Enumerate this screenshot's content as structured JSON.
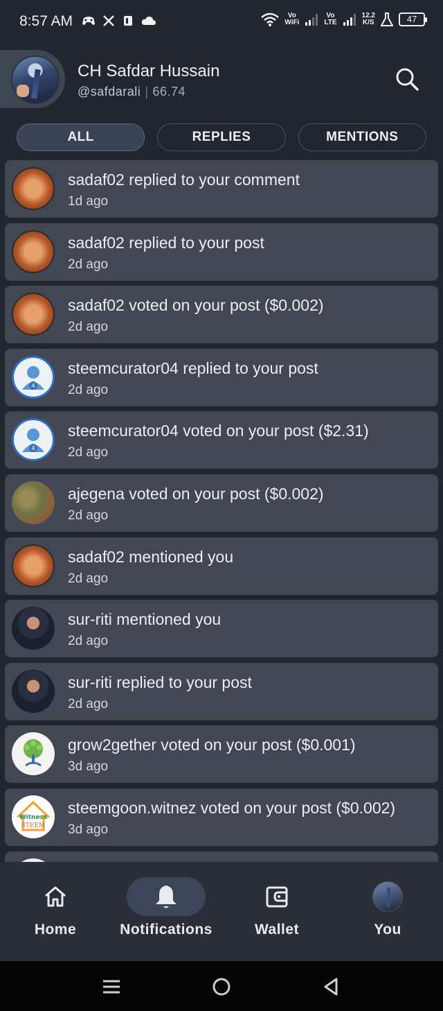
{
  "status_bar": {
    "time": "8:57 AM",
    "left_icons": [
      "gamepad-icon",
      "x-icon",
      "app-icon",
      "cloud-icon"
    ],
    "wifi_label": "Vo\nWiFi",
    "lte_label": "Vo\nLTE",
    "speed": "12.2\nK/S",
    "battery": "47"
  },
  "header": {
    "name": "CH Safdar Hussain",
    "handle": "@safdarali",
    "reputation": "66.74"
  },
  "tabs": [
    {
      "label": "ALL",
      "active": true
    },
    {
      "label": "REPLIES",
      "active": false
    },
    {
      "label": "MENTIONS",
      "active": false
    }
  ],
  "notifications": [
    {
      "text": "sadaf02 replied to your comment",
      "time": "1d ago",
      "avatar": "sadaf"
    },
    {
      "text": "sadaf02 replied to your post",
      "time": "2d ago",
      "avatar": "sadaf"
    },
    {
      "text": "sadaf02 voted on your post ($0.002)",
      "time": "2d ago",
      "avatar": "sadaf"
    },
    {
      "text": "steemcurator04 replied to your post",
      "time": "2d ago",
      "avatar": "steem"
    },
    {
      "text": "steemcurator04 voted on your post ($2.31)",
      "time": "2d ago",
      "avatar": "steem"
    },
    {
      "text": "ajegena voted on your post ($0.002)",
      "time": "2d ago",
      "avatar": "ajegena"
    },
    {
      "text": "sadaf02 mentioned you",
      "time": "2d ago",
      "avatar": "sadaf"
    },
    {
      "text": "sur-riti mentioned you",
      "time": "2d ago",
      "avatar": "sur"
    },
    {
      "text": "sur-riti replied to your post",
      "time": "2d ago",
      "avatar": "sur"
    },
    {
      "text": "grow2gether voted on your post ($0.001)",
      "time": "3d ago",
      "avatar": "grow"
    },
    {
      "text": "steemgoon.witnez voted on your post ($0.002)",
      "time": "3d ago",
      "avatar": "witnez"
    }
  ],
  "bottom_nav": [
    {
      "label": "Home",
      "icon": "home-icon",
      "active": false
    },
    {
      "label": "Notifications",
      "icon": "bell-icon",
      "active": true
    },
    {
      "label": "Wallet",
      "icon": "wallet-icon",
      "active": false
    },
    {
      "label": "You",
      "icon": "profile-avatar",
      "active": false
    }
  ],
  "colors": {
    "background": "#22272f",
    "card": "#424753",
    "active_tab": "#3a4456",
    "nav_bar": "#2a2f37"
  }
}
